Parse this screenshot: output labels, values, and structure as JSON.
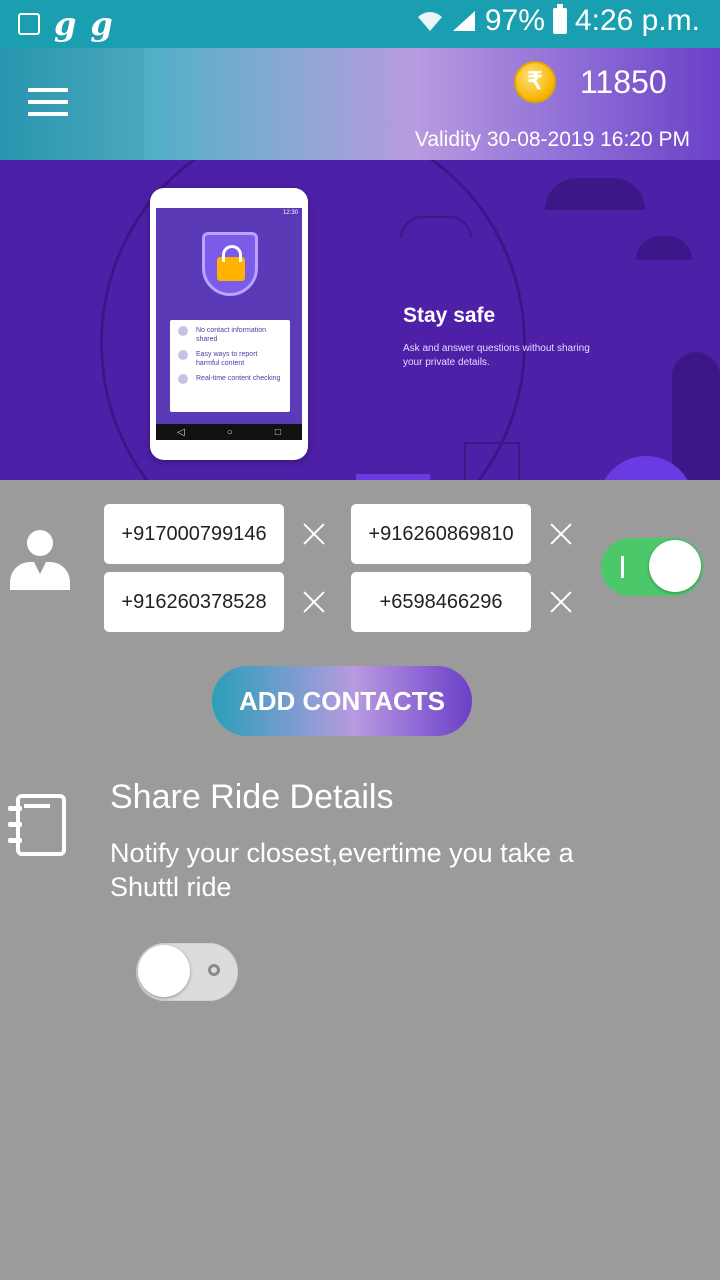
{
  "status_bar": {
    "g1": "g",
    "g2": "g",
    "battery_percent": "97%",
    "time": "4:26 p.m."
  },
  "header": {
    "coin_symbol": "₹",
    "points": "11850",
    "validity": "Validity 30-08-2019 16:20 PM"
  },
  "banner": {
    "title": "Stay safe",
    "subtitle": "Ask and answer questions without sharing your private details.",
    "phone_time": "12:30",
    "card_items": [
      "No contact information shared",
      "Easy ways to report harmful content",
      "Real-time content checking"
    ]
  },
  "contacts": [
    "+917000799146",
    "+916260869810",
    "+916260378528",
    "+6598466296"
  ],
  "contacts_toggle_on": true,
  "add_contacts_label": "ADD CONTACTS",
  "share": {
    "title": "Share Ride Details",
    "description": "Notify your closest,evertime you take a Shuttl ride",
    "enabled": false
  },
  "colors": {
    "status_bar": "#1a9fb0",
    "banner": "#4e20a8",
    "background": "#9b9b9b",
    "toggle_on": "#4cc76a"
  }
}
